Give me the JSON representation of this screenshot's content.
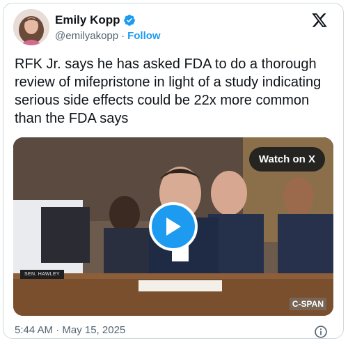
{
  "author": {
    "display_name": "Emily Kopp",
    "handle": "@emilyakopp",
    "separator": "·",
    "follow_label": "Follow",
    "verified": true
  },
  "tweet": {
    "text": "RFK Jr. says he has asked FDA to do a thorough review of mifepristone in light of a study indicating serious side effects could be 22x more common than the FDA says"
  },
  "media": {
    "watch_label": "Watch on X",
    "nameplate": "SEN. HAWLEY",
    "broadcaster": "C-SPAN"
  },
  "footer": {
    "timestamp": "5:44 AM · May 15, 2025"
  },
  "colors": {
    "accent": "#1d9bf0",
    "text": "#0f1419",
    "muted": "#536471"
  },
  "icons": [
    "verified-badge-icon",
    "x-logo-icon",
    "play-icon",
    "info-icon"
  ]
}
